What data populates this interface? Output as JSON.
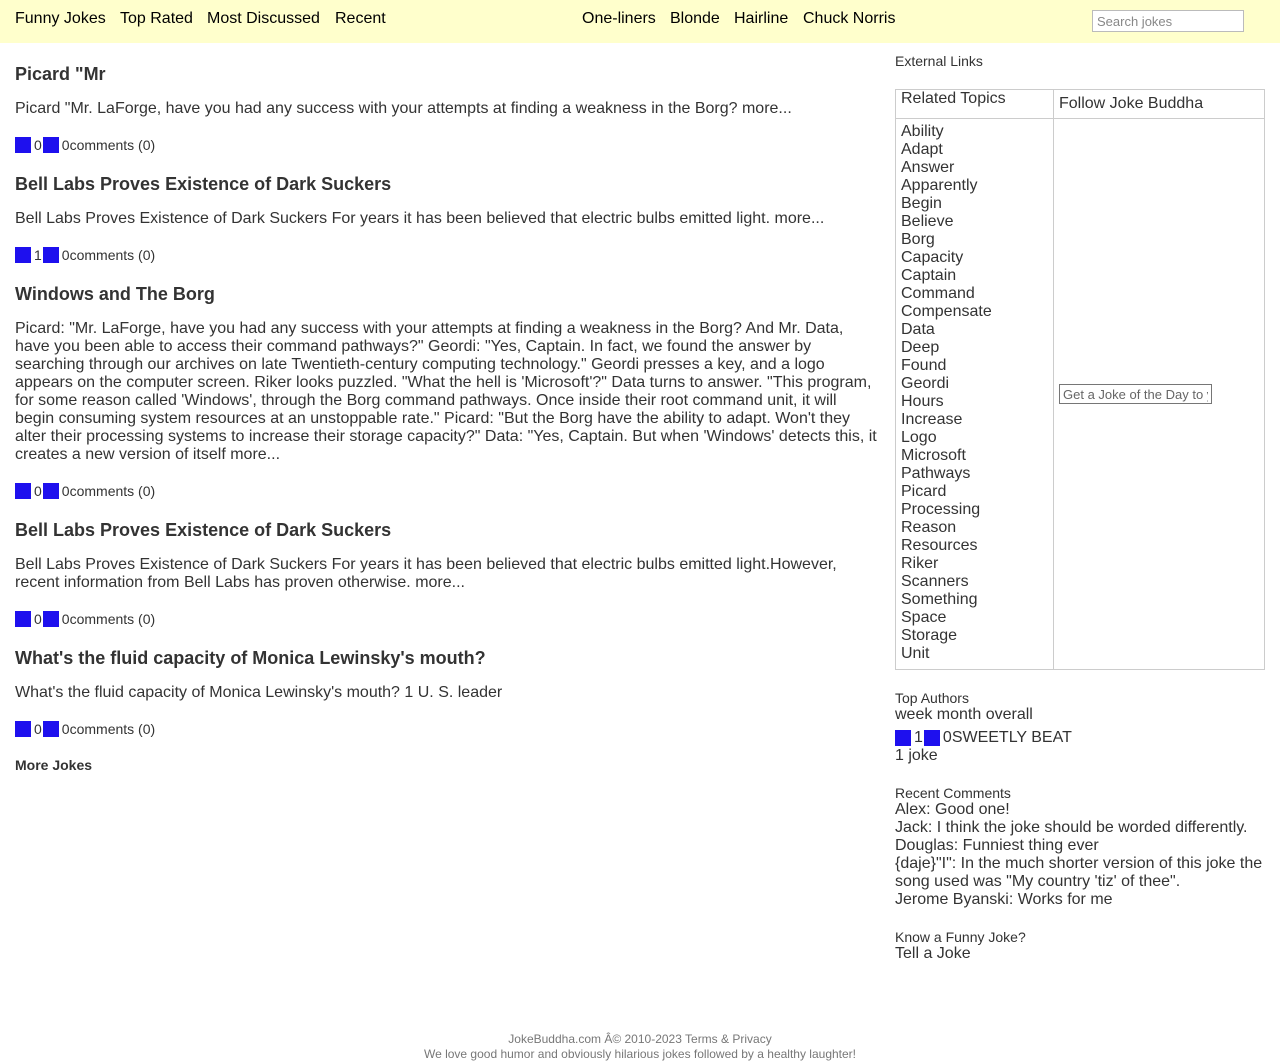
{
  "nav": {
    "left": [
      "Funny Jokes",
      "Top Rated",
      "Most Discussed",
      "Recent"
    ],
    "center": [
      "One-liners",
      "Blonde",
      "Hairline",
      "Chuck Norris"
    ],
    "search_placeholder": "Search jokes"
  },
  "jokes": [
    {
      "title": "Picard \"Mr",
      "body": "Picard \"Mr. LaForge, have you had any success with your attempts at finding a weakness in the Borg?",
      "more": "more...",
      "up": "0",
      "down": "0",
      "comments": "comments (0)"
    },
    {
      "title": "Bell Labs Proves Existence of Dark Suckers",
      "body": "Bell Labs Proves Existence of Dark Suckers For years it has been believed that electric bulbs emitted light.",
      "more": "more...",
      "up": "1",
      "down": "0",
      "comments": "comments (0)"
    },
    {
      "title": "Windows and The Borg",
      "body": "Picard: \"Mr. LaForge, have you had any success with your attempts at finding a weakness in the Borg? And Mr. Data, have you been able to access their command pathways?\" Geordi: \"Yes, Captain. In fact, we found the answer by searching through our archives on late Twentieth-century computing technology.\" Geordi presses a key, and a logo appears on the computer screen. Riker looks puzzled. \"What the hell is 'Microsoft'?\" Data turns to answer. \"This program, for some reason called 'Windows', through the Borg command pathways. Once inside their root command unit, it will begin consuming system resources at an unstoppable rate.\" Picard: \"But the Borg have the ability to adapt. Won't they alter their processing systems to increase their storage capacity?\" Data: \"Yes, Captain. But when 'Windows' detects this, it creates a new version of itself",
      "more": "more...",
      "up": "0",
      "down": "0",
      "comments": "comments (0)"
    },
    {
      "title": "Bell Labs Proves Existence of Dark Suckers",
      "body": "Bell Labs Proves Existence of Dark Suckers For years it has been believed that electric bulbs emitted light.However, recent information from Bell Labs has proven otherwise.",
      "more": "more...",
      "up": "0",
      "down": "0",
      "comments": "comments (0)"
    },
    {
      "title": "What's the fluid capacity of Monica Lewinsky's mouth?",
      "body": "What's the fluid capacity of Monica Lewinsky's mouth? 1 U. S. leader",
      "more": "",
      "up": "0",
      "down": "0",
      "comments": "comments (0)"
    }
  ],
  "more_jokes": "More Jokes",
  "sidebar": {
    "external_links": "External Links",
    "related_topics_header": "Related Topics",
    "follow_header": "Follow Joke Buddha",
    "topics": [
      "Ability",
      "Adapt",
      "Answer",
      "Apparently",
      "Begin",
      "Believe",
      "Borg",
      "Capacity",
      "Captain",
      "Command",
      "Compensate",
      "Data",
      "Deep",
      "Found",
      "Geordi",
      "Hours",
      "Increase",
      "Logo",
      "Microsoft",
      "Pathways",
      "Picard",
      "Processing",
      "Reason",
      "Resources",
      "Riker",
      "Scanners",
      "Something",
      "Space",
      "Storage",
      "Unit"
    ],
    "jod_placeholder": "Get a Joke of the Day to your inbox",
    "top_authors": "Top Authors",
    "periods": "week month overall",
    "author": {
      "up": "1",
      "down": "0",
      "name": "SWEETLY BEAT",
      "count": "1 joke"
    },
    "recent_comments": "Recent Comments",
    "comments": [
      "Alex: Good one!",
      "Jack: I think the joke should be worded differently.",
      "Douglas: Funniest thing ever",
      "{daje}\"I\": In the much shorter version of this joke the song used was \"My country 'tiz' of thee\".",
      "Jerome Byanski: Works for me"
    ],
    "know_joke": "Know a Funny Joke?",
    "tell_joke": "Tell a Joke"
  },
  "footer": {
    "line1_prefix": "JokeBuddha.com Â© 2010-2023",
    "terms": "Terms",
    "amp": "&",
    "privacy": "Privacy",
    "line2": "We love good humor and obviously hilarious jokes followed by a healthy laughter!"
  },
  "colors": {
    "topbar": "#ffffcc",
    "vote_square": "#1e10ee",
    "text": "#333333"
  }
}
